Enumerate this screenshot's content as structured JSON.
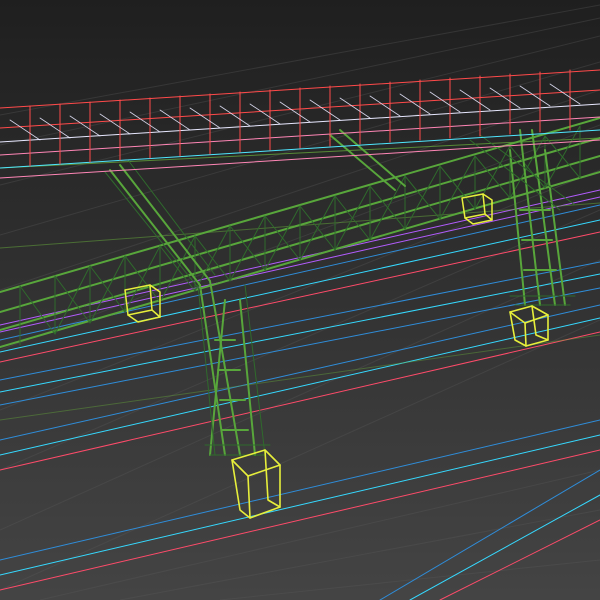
{
  "scene": {
    "kind": "3d-wireframe-viewport",
    "background": "#2b2b2b",
    "colors": {
      "deck_red": "#ff4a4a",
      "deck_white": "#e8e8ff",
      "deck_pink": "#ff86b6",
      "deck_cyan": "#4fe7ff",
      "structure_green": "#58a63b",
      "structure_dark_green": "#2f6b2c",
      "pier_yellow": "#e7ef3b",
      "track_blue": "#2f8dd9",
      "track_cyan": "#36d9ff",
      "track_purple": "#b35cff",
      "track_red": "#ff4b6a",
      "ground_lines": "#63a33a"
    },
    "objects": {
      "rail_bridge": "rail-bridge-wireframe",
      "pier_bases": "pier-base-wireframes",
      "tracks": "track-wireframes",
      "ground_guides": "ground-guide-lines"
    }
  }
}
